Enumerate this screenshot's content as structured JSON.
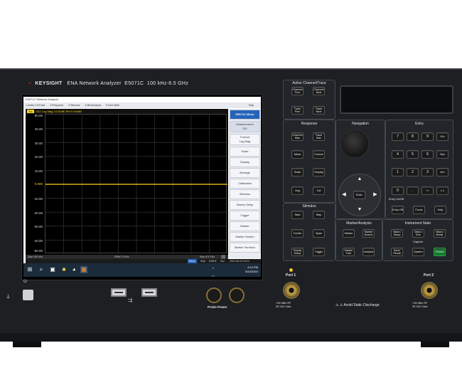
{
  "brand": {
    "name": "KEYSIGHT",
    "model": "ENA Network Analyzer",
    "part": "E5071C",
    "range": "100 kHz-8.5 GHz"
  },
  "window": {
    "title": "E5071C Network Analyzer"
  },
  "menubar": {
    "items": [
      "1 Active Ch/Trace",
      "2 Response",
      "3 Stimulus",
      "4 Mkr/Analysis",
      "5 Instr State"
    ],
    "help": "Help"
  },
  "trace": {
    "tag": "Tr1",
    "header": "S11 Log Mag 10.00dB/ Ref 0.000dB"
  },
  "y_ticks": [
    "50.00",
    "40.00",
    "30.00",
    "20.00",
    "10.00",
    "0.000",
    "-10.00",
    "-20.00",
    "-30.00",
    "-40.00",
    "-50.00"
  ],
  "softkeys": [
    "E5071C Menu",
    "Measurement\nS11",
    "Format\nLog Mag",
    "Scale",
    "Display",
    "Average",
    "Calibration",
    "Stimulus",
    "Sweep Setup",
    "Trigger",
    "Marker",
    "Marker Search",
    "Marker Function"
  ],
  "status": {
    "start": "Start 100 kHz",
    "ifbw": "IFBW 70 kHz",
    "stop": "Stop 8.5 GHz",
    "ch": "C1"
  },
  "status2": {
    "meas": "Meas",
    "stop": "Stop",
    "extref": "ExtRef",
    "svc": "Svc",
    "datetime": "2024-05-10 16:24"
  },
  "taskbar": {
    "time": "4:24 PM",
    "date": "5/10/2024"
  },
  "groups": {
    "active_channel": {
      "label": "Active Channel/Trace",
      "keys": [
        "Channel Prev",
        "Channel Next",
        "Trace Prev",
        "Trace Next"
      ]
    },
    "response": {
      "label": "Response",
      "keys": [
        "Channel Max",
        "Trace Max",
        "Meas",
        "Format",
        "Scale",
        "Display",
        "Avg",
        "Cal"
      ]
    },
    "navigation": {
      "label": "Navigation",
      "enter": "Enter"
    },
    "entry": {
      "label": "Entry",
      "keys": [
        "7",
        "8",
        "9",
        "G/n",
        "4",
        "5",
        "6",
        "M/μ",
        "1",
        "2",
        "3",
        "k/m",
        "0",
        ".",
        "+/-",
        "x 1"
      ],
      "backspace_note": "Entry On/Off",
      "bottom": [
        "Entry Off",
        "Focus",
        "Help"
      ]
    },
    "stimulus": {
      "label": "Stimulus",
      "keys": [
        "Start",
        "Stop",
        "Center",
        "Span",
        "Sweep Setup",
        "Trigger"
      ]
    },
    "marker": {
      "label": "Marker/Analysis",
      "keys": [
        "Marker",
        "Marker Search",
        "Marker Fctn",
        "Analysis"
      ]
    },
    "instrument": {
      "label": "Instrument State",
      "keys": [
        "Macro Setup",
        "Macro Run",
        "Macro Break"
      ],
      "capture": "Capture",
      "keys2": [
        "Save/ Recall",
        "System",
        "Preset"
      ]
    }
  },
  "front": {
    "probe_power": "Probe Power",
    "port1": "Port 1",
    "port2": "Port 2",
    "port_spec": "+26 dBm RF\n35 VDC Max",
    "esd": "Avoid Static Discharge"
  },
  "colors": {
    "trace": "#ffd21a",
    "preset": "#167a2e",
    "chassis": "#1d1f22",
    "menu_blue": "#2563b8"
  }
}
